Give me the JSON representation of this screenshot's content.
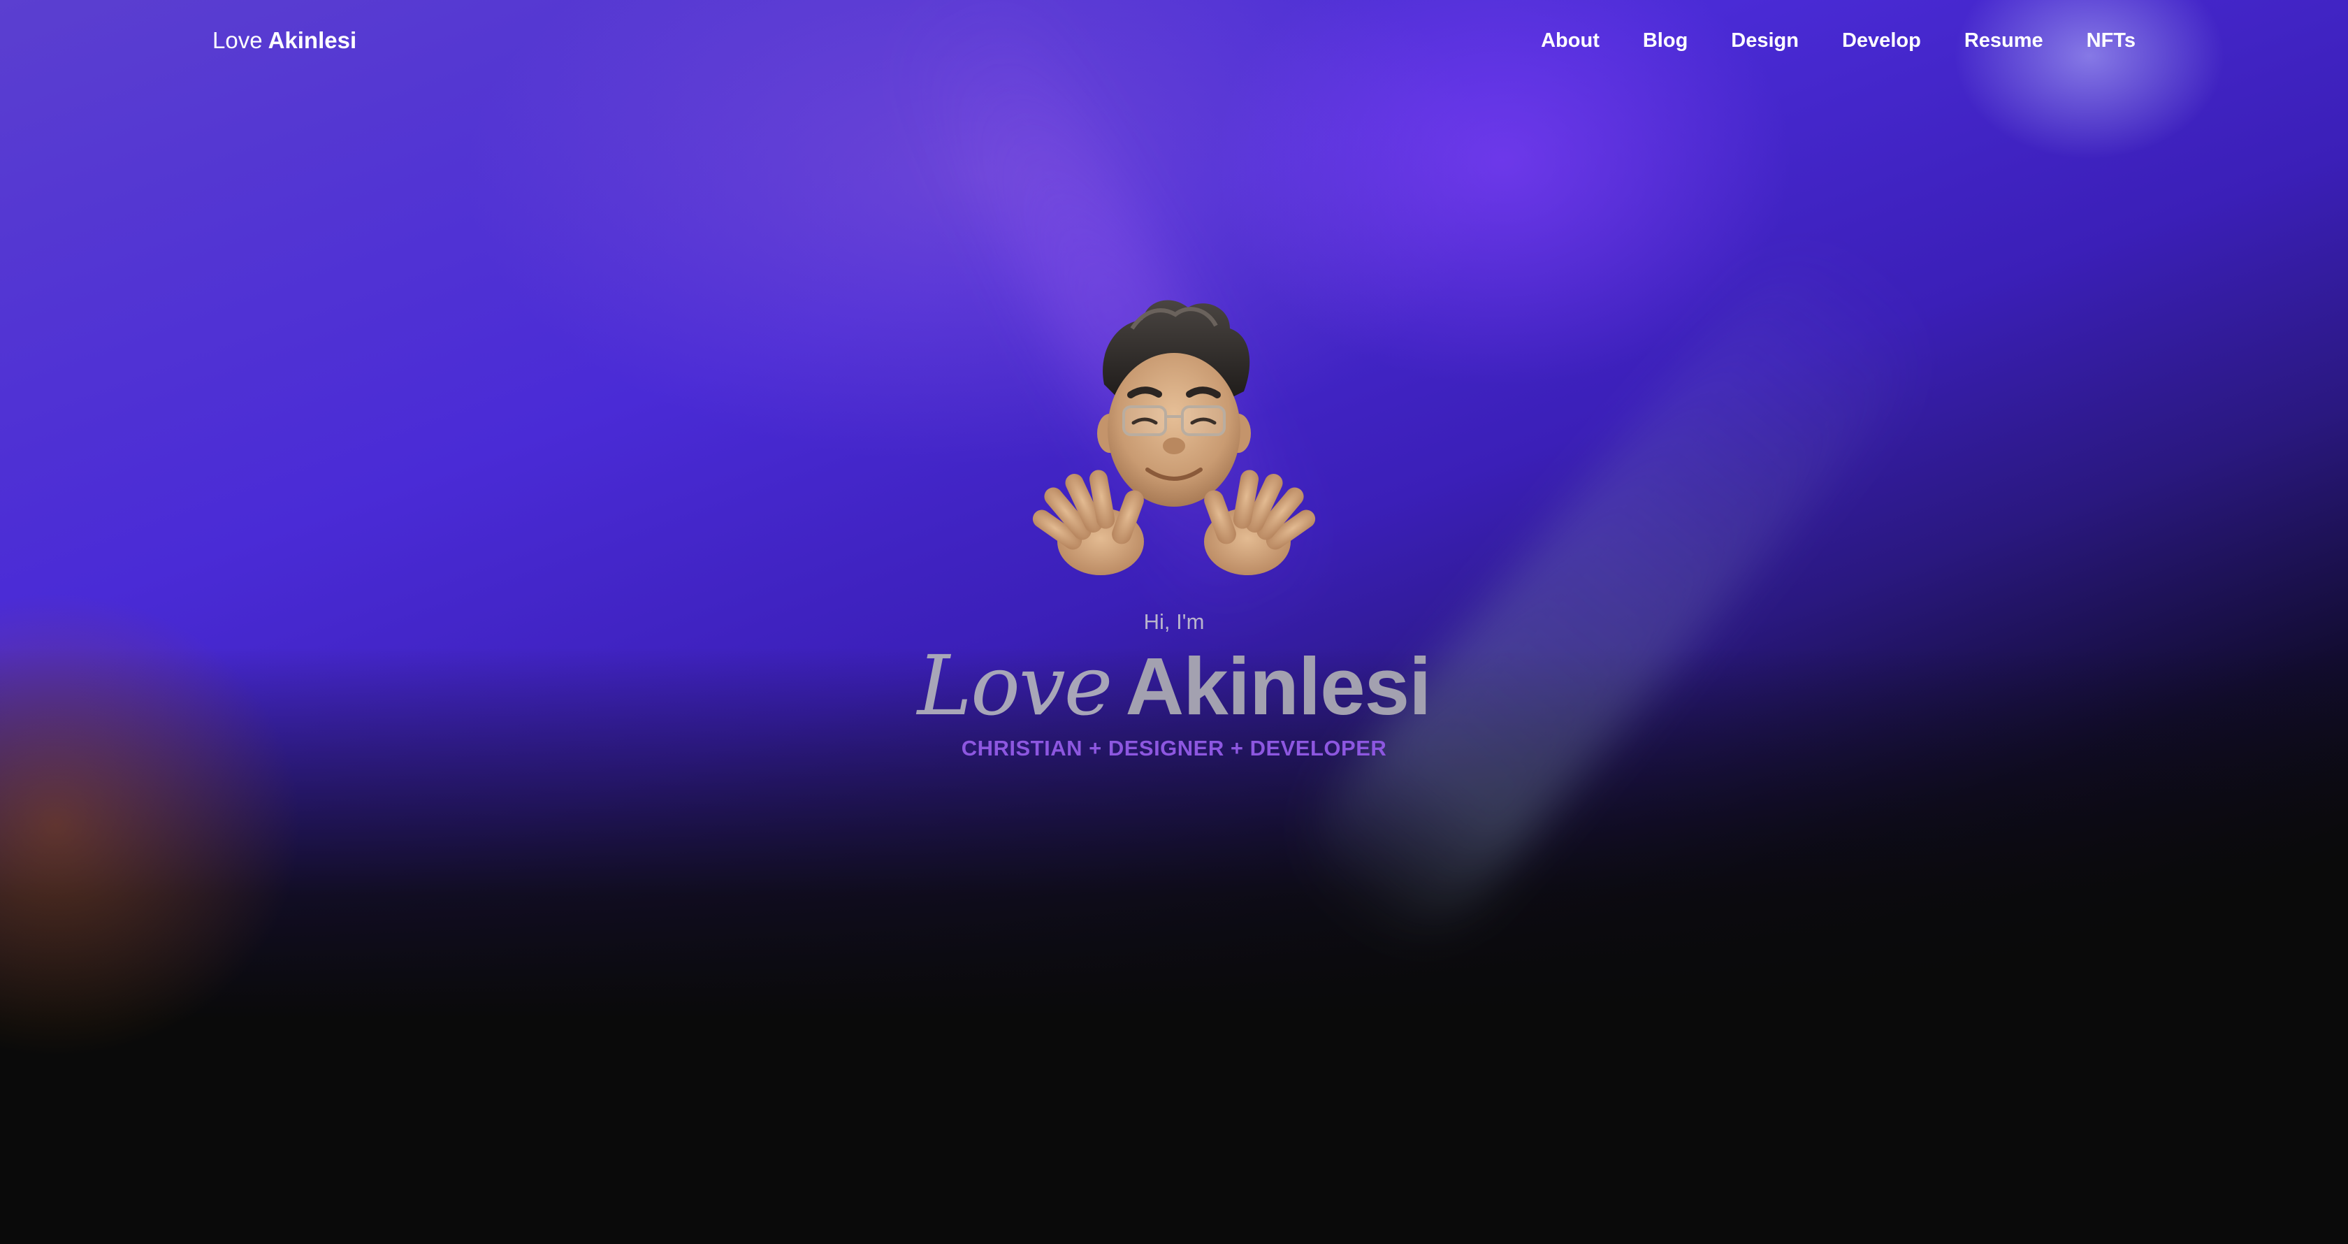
{
  "header": {
    "brand_first": "Love",
    "brand_last": "Akinlesi",
    "nav": [
      "About",
      "Blog",
      "Design",
      "Develop",
      "Resume",
      "NFTs"
    ]
  },
  "hero": {
    "avatar_icon": "waving-memoji-avatar",
    "greeting": "Hi, I'm",
    "name_first": "Love",
    "name_last": "Akinlesi",
    "tagline": "CHRISTIAN + DESIGNER + DEVELOPER"
  },
  "colors": {
    "accent": "#8d57e0",
    "background": "#0a0a0a",
    "gradient_top": "#4a2bd6"
  }
}
